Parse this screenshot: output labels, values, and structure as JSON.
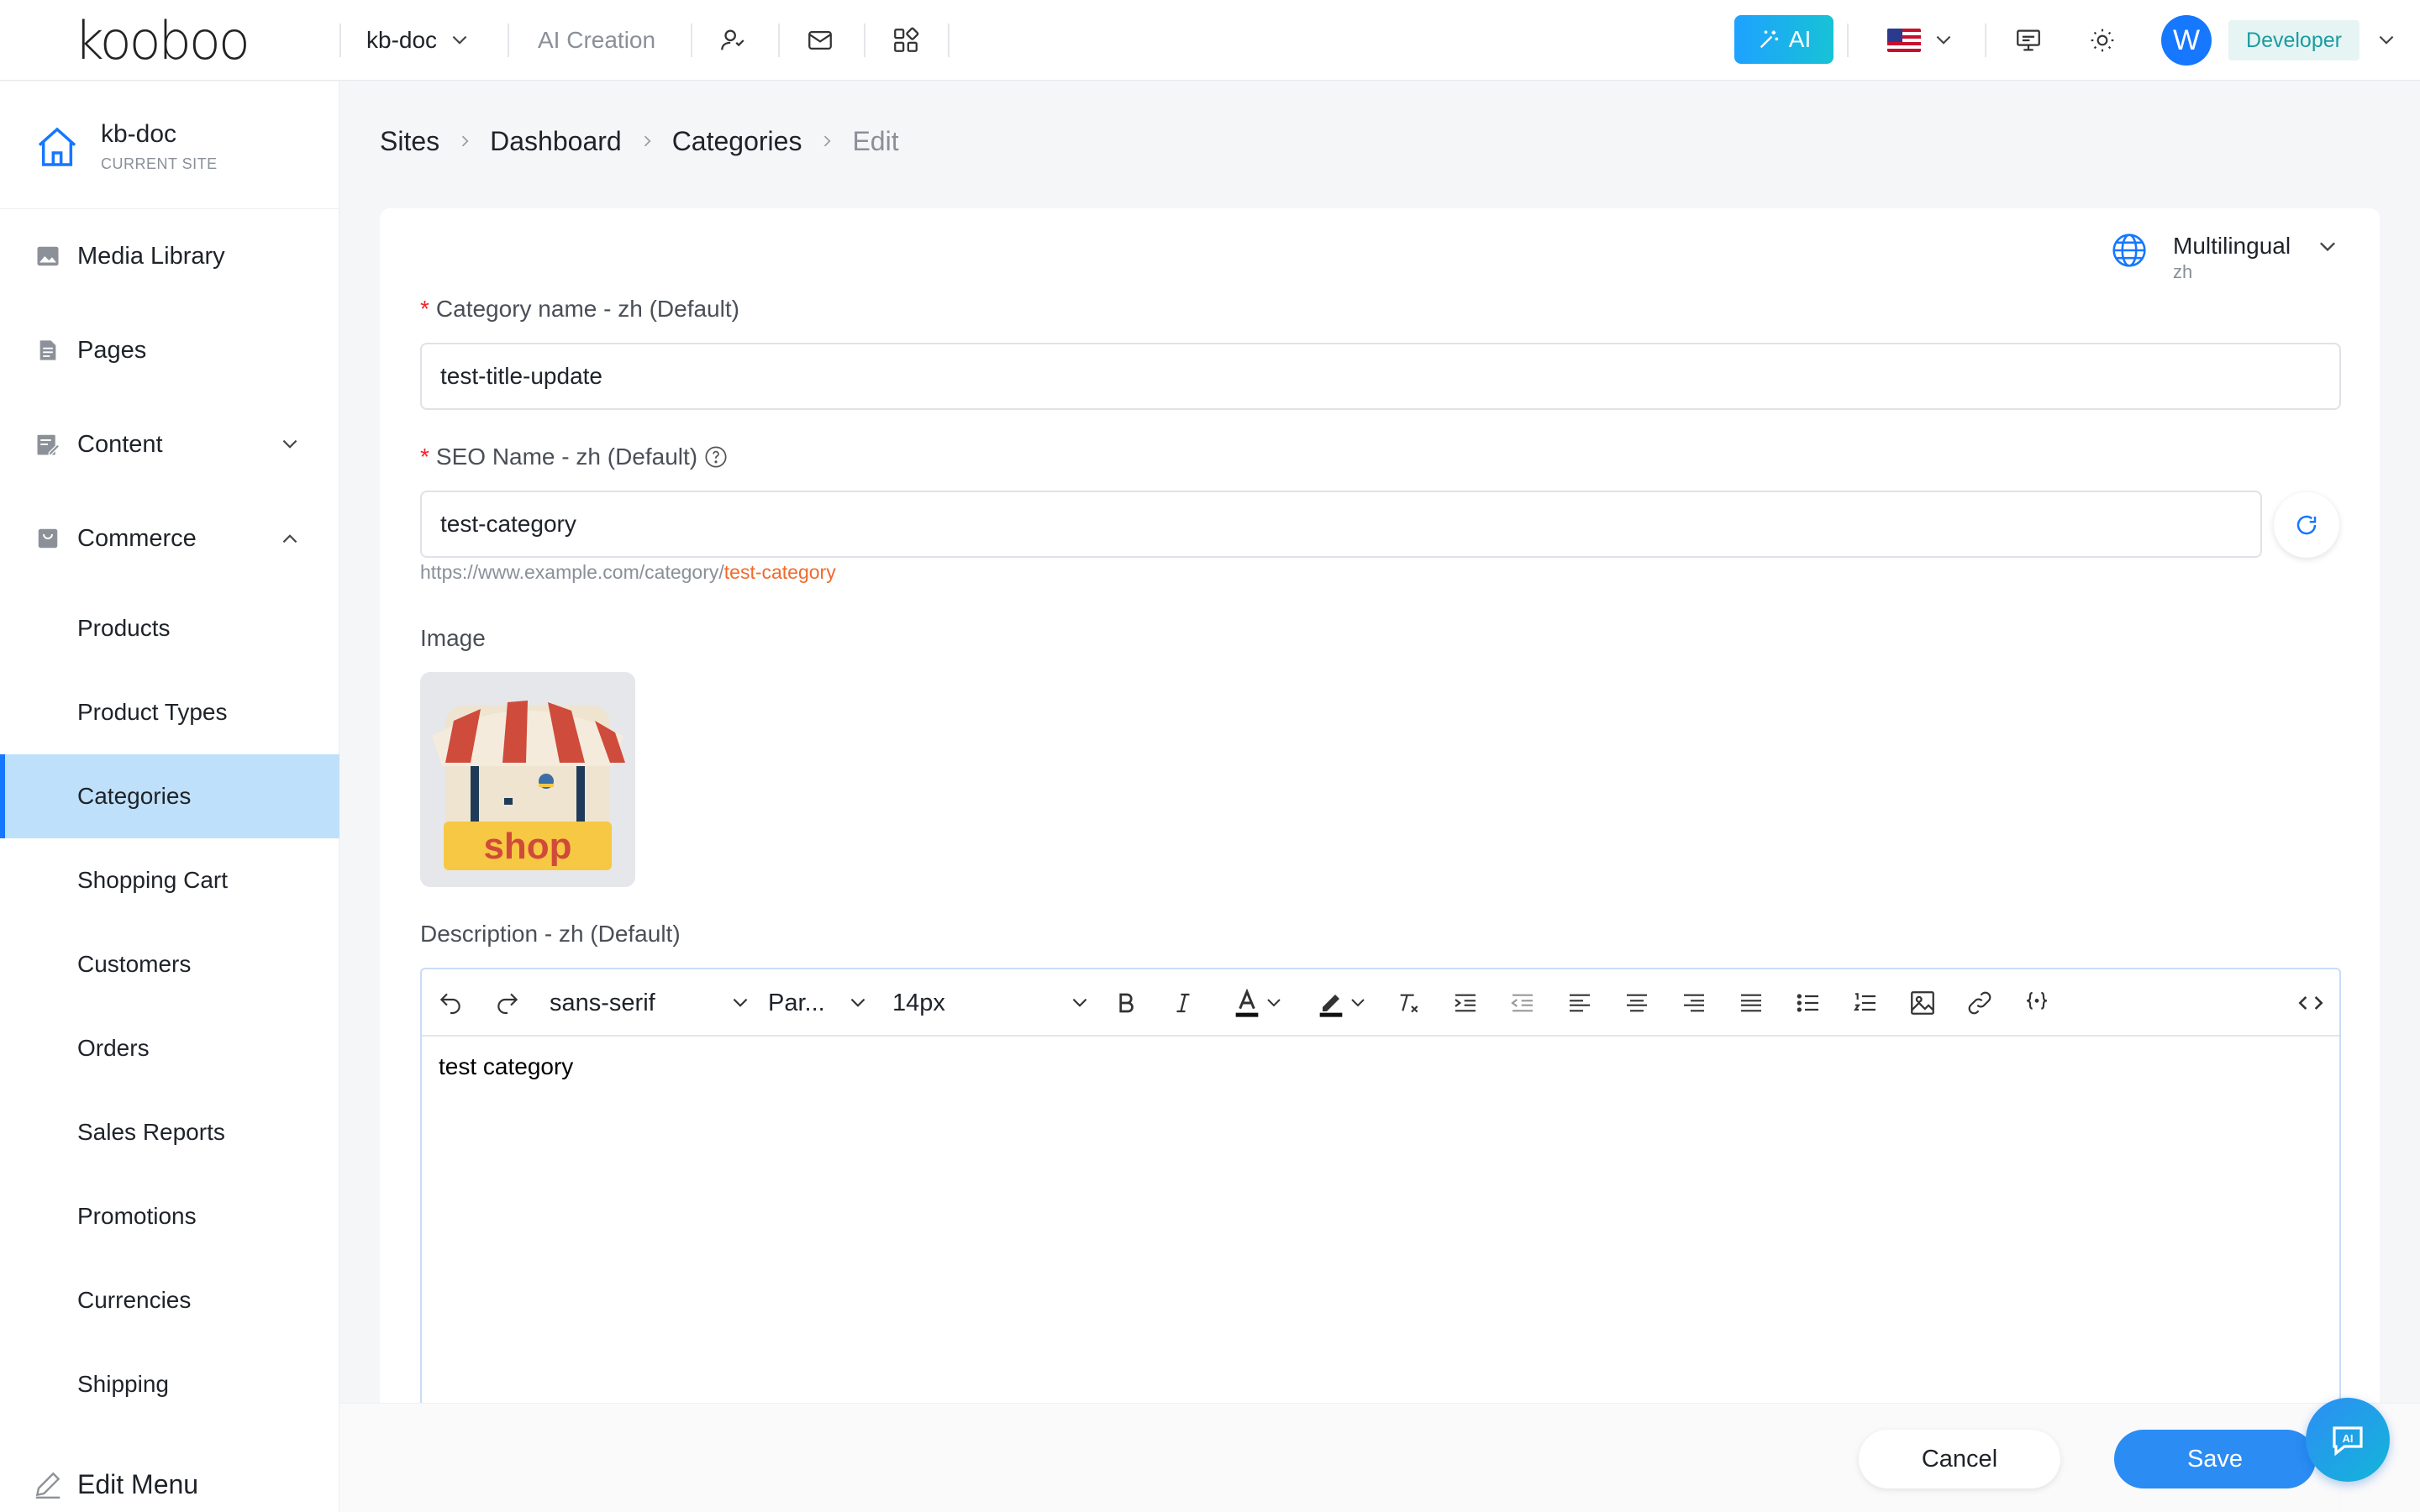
{
  "header": {
    "logo": "kooboo",
    "site_selector": "kb-doc",
    "ai_creation": "AI Creation",
    "ai_button": "AI",
    "avatar_letter": "W",
    "role": "Developer"
  },
  "sidebar": {
    "current_site": {
      "name": "kb-doc",
      "caption": "CURRENT SITE"
    },
    "items": [
      {
        "label": "Media Library",
        "icon": "image-icon"
      },
      {
        "label": "Pages",
        "icon": "document-icon"
      },
      {
        "label": "Content",
        "icon": "edit-document-icon"
      },
      {
        "label": "Commerce",
        "icon": "shop-bag-icon"
      }
    ],
    "commerce_children": [
      "Products",
      "Product Types",
      "Categories",
      "Shopping Cart",
      "Customers",
      "Orders",
      "Sales Reports",
      "Promotions",
      "Currencies",
      "Shipping"
    ],
    "active_item": "Categories",
    "edit_menu": "Edit Menu"
  },
  "breadcrumb": [
    "Sites",
    "Dashboard",
    "Categories",
    "Edit"
  ],
  "form": {
    "multilingual": {
      "label": "Multilingual",
      "lang": "zh"
    },
    "category_name": {
      "label": "Category name - zh (Default)",
      "value": "test-title-update"
    },
    "seo_name": {
      "label": "SEO Name - zh (Default)",
      "value": "test-category",
      "url_prefix": "https://www.example.com/category/",
      "url_slug": "test-category"
    },
    "image_label": "Image",
    "image_text": "shop",
    "description": {
      "label": "Description - zh (Default)",
      "font_family": "sans-serif",
      "block_format": "Par...",
      "font_size": "14px",
      "content": "test category"
    }
  },
  "actions": {
    "cancel": "Cancel",
    "save": "Save"
  },
  "colors": {
    "primary": "#1677ff",
    "active_bg": "#bfe0fa",
    "required": "#f5222d",
    "slug": "#f06a2a"
  }
}
